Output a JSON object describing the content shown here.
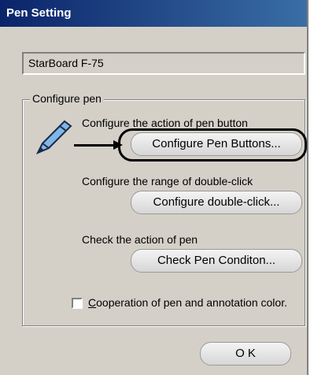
{
  "window": {
    "title": "Pen Setting"
  },
  "device": {
    "name": "StarBoard F-75"
  },
  "group": {
    "label": "Configure pen"
  },
  "actions": [
    {
      "description": "Configure the action of pen button",
      "button_label": "Configure Pen Buttons..."
    },
    {
      "description": "Configure the range of double-click",
      "button_label": "Configure double-click..."
    },
    {
      "description": "Check the action of pen",
      "button_label": "Check Pen Conditon..."
    }
  ],
  "cooperation": {
    "accel_letter": "C",
    "label_rest": "ooperation of pen and annotation color.",
    "checked": false
  },
  "ok_button": {
    "label": "O K"
  },
  "icons": {
    "pen": "pen-icon"
  }
}
